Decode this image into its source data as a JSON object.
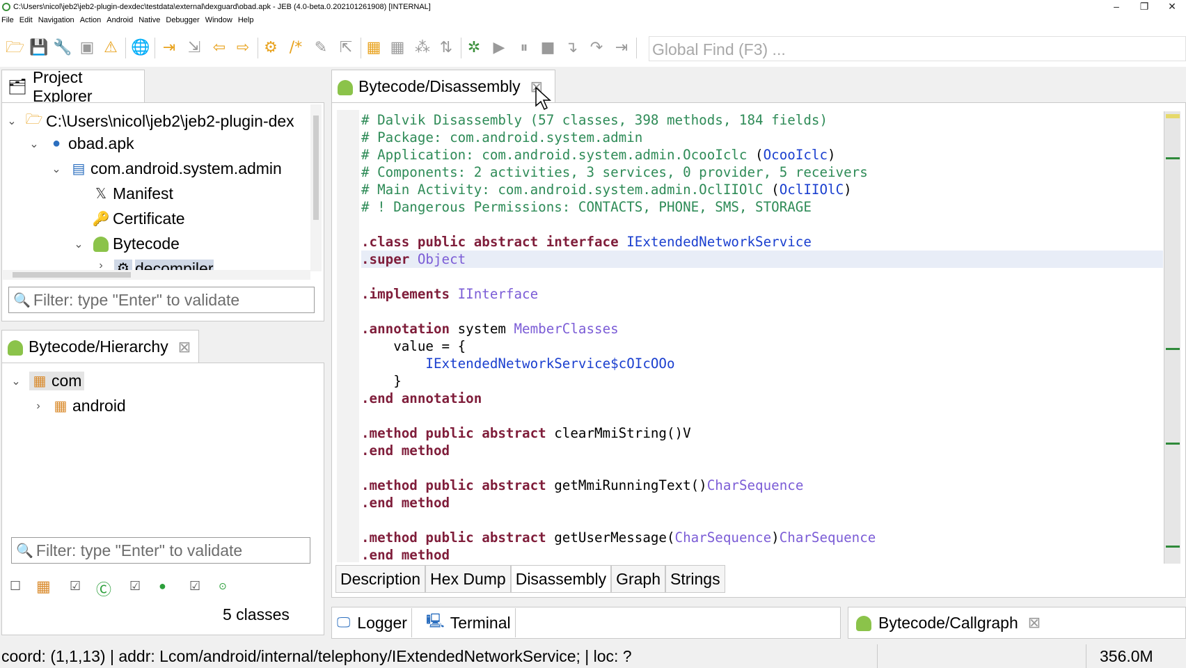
{
  "window": {
    "title": "C:\\Users\\nicol\\jeb2\\jeb2-plugin-dexdec\\testdata\\external\\dexguard\\obad.apk - JEB (4.0-beta.0.202101261908) [INTERNAL]",
    "minimize": "–",
    "maximize": "❐",
    "close": "✕"
  },
  "menu": [
    "File",
    "Edit",
    "Navigation",
    "Action",
    "Android",
    "Native",
    "Debugger",
    "Window",
    "Help"
  ],
  "toolbar": {
    "global_find_placeholder": "Global Find (F3) ..."
  },
  "project_explorer": {
    "tab_label": "Project Explorer",
    "tree": [
      {
        "label": "C:\\Users\\nicol\\jeb2\\jeb2-plugin-dex",
        "expanded": true
      },
      {
        "label": "obad.apk",
        "expanded": true
      },
      {
        "label": "com.android.system.admin",
        "expanded": true
      },
      {
        "label": "Manifest"
      },
      {
        "label": "Certificate"
      },
      {
        "label": "Bytecode",
        "expanded": true
      },
      {
        "label": "decompiler"
      }
    ],
    "filter_placeholder": "Filter: type \"Enter\" to validate"
  },
  "hierarchy": {
    "tab_label": "Bytecode/Hierarchy",
    "tree": [
      {
        "label": "com",
        "expanded": true
      },
      {
        "label": "android",
        "expanded": false
      }
    ],
    "filter_placeholder": "Filter: type \"Enter\" to validate",
    "class_count": "5 classes"
  },
  "editor": {
    "tab_label": "Bytecode/Disassembly",
    "lines": [
      [
        [
          "c",
          "# Dalvik Disassembly (57 classes, 398 methods, 184 fields)"
        ]
      ],
      [
        [
          "c",
          "# Package: com.android.system.admin"
        ]
      ],
      [
        [
          "c",
          "# Application: com.android.system.admin.OcooIclc "
        ],
        [
          "n",
          "("
        ],
        [
          "l",
          "OcooIclc"
        ],
        [
          "n",
          ")"
        ]
      ],
      [
        [
          "c",
          "# Components: 2 activities, 3 services, 0 provider, 5 receivers"
        ]
      ],
      [
        [
          "c",
          "# Main Activity: com.android.system.admin.OclIIOlC "
        ],
        [
          "n",
          "("
        ],
        [
          "l",
          "OclIIOlC"
        ],
        [
          "n",
          ")"
        ]
      ],
      [
        [
          "c",
          "# ! Dangerous Permissions: CONTACTS, PHONE, SMS, STORAGE"
        ]
      ],
      [],
      [
        [
          "k",
          ".class public abstract interface "
        ],
        [
          "l",
          "IExtendedNetworkService"
        ]
      ],
      [
        [
          "k",
          ".super "
        ],
        [
          "t",
          "Object"
        ]
      ],
      [],
      [
        [
          "k",
          ".implements "
        ],
        [
          "t",
          "IInterface"
        ]
      ],
      [],
      [
        [
          "k",
          ".annotation "
        ],
        [
          "n",
          "system "
        ],
        [
          "t",
          "MemberClasses"
        ]
      ],
      [
        [
          "n",
          "    value = {"
        ]
      ],
      [
        [
          "n",
          "        "
        ],
        [
          "l",
          "IExtendedNetworkService$cOIcOOo"
        ]
      ],
      [
        [
          "n",
          "    }"
        ]
      ],
      [
        [
          "k",
          ".end annotation"
        ]
      ],
      [],
      [
        [
          "k",
          ".method public abstract "
        ],
        [
          "n",
          "clearMmiString()V"
        ]
      ],
      [
        [
          "k",
          ".end method"
        ]
      ],
      [],
      [
        [
          "k",
          ".method public abstract "
        ],
        [
          "n",
          "getMmiRunningText()"
        ],
        [
          "t",
          "CharSequence"
        ]
      ],
      [
        [
          "k",
          ".end method"
        ]
      ],
      [],
      [
        [
          "k",
          ".method public abstract "
        ],
        [
          "n",
          "getUserMessage("
        ],
        [
          "t",
          "CharSequence"
        ],
        [
          "n",
          ")"
        ],
        [
          "t",
          "CharSequence"
        ]
      ],
      [
        [
          "k",
          ".end method"
        ]
      ]
    ],
    "bottom_tabs": [
      "Description",
      "Hex Dump",
      "Disassembly",
      "Graph",
      "Strings"
    ],
    "active_bottom_tab": "Disassembly"
  },
  "bottom_panel": {
    "tabs": [
      "Logger",
      "Terminal"
    ],
    "callgraph_tab": "Bytecode/Callgraph"
  },
  "status": {
    "coord": "coord: (1,1,13) | addr: Lcom/android/internal/telephony/IExtendedNetworkService; | loc: ?",
    "memory": "356.0M"
  }
}
